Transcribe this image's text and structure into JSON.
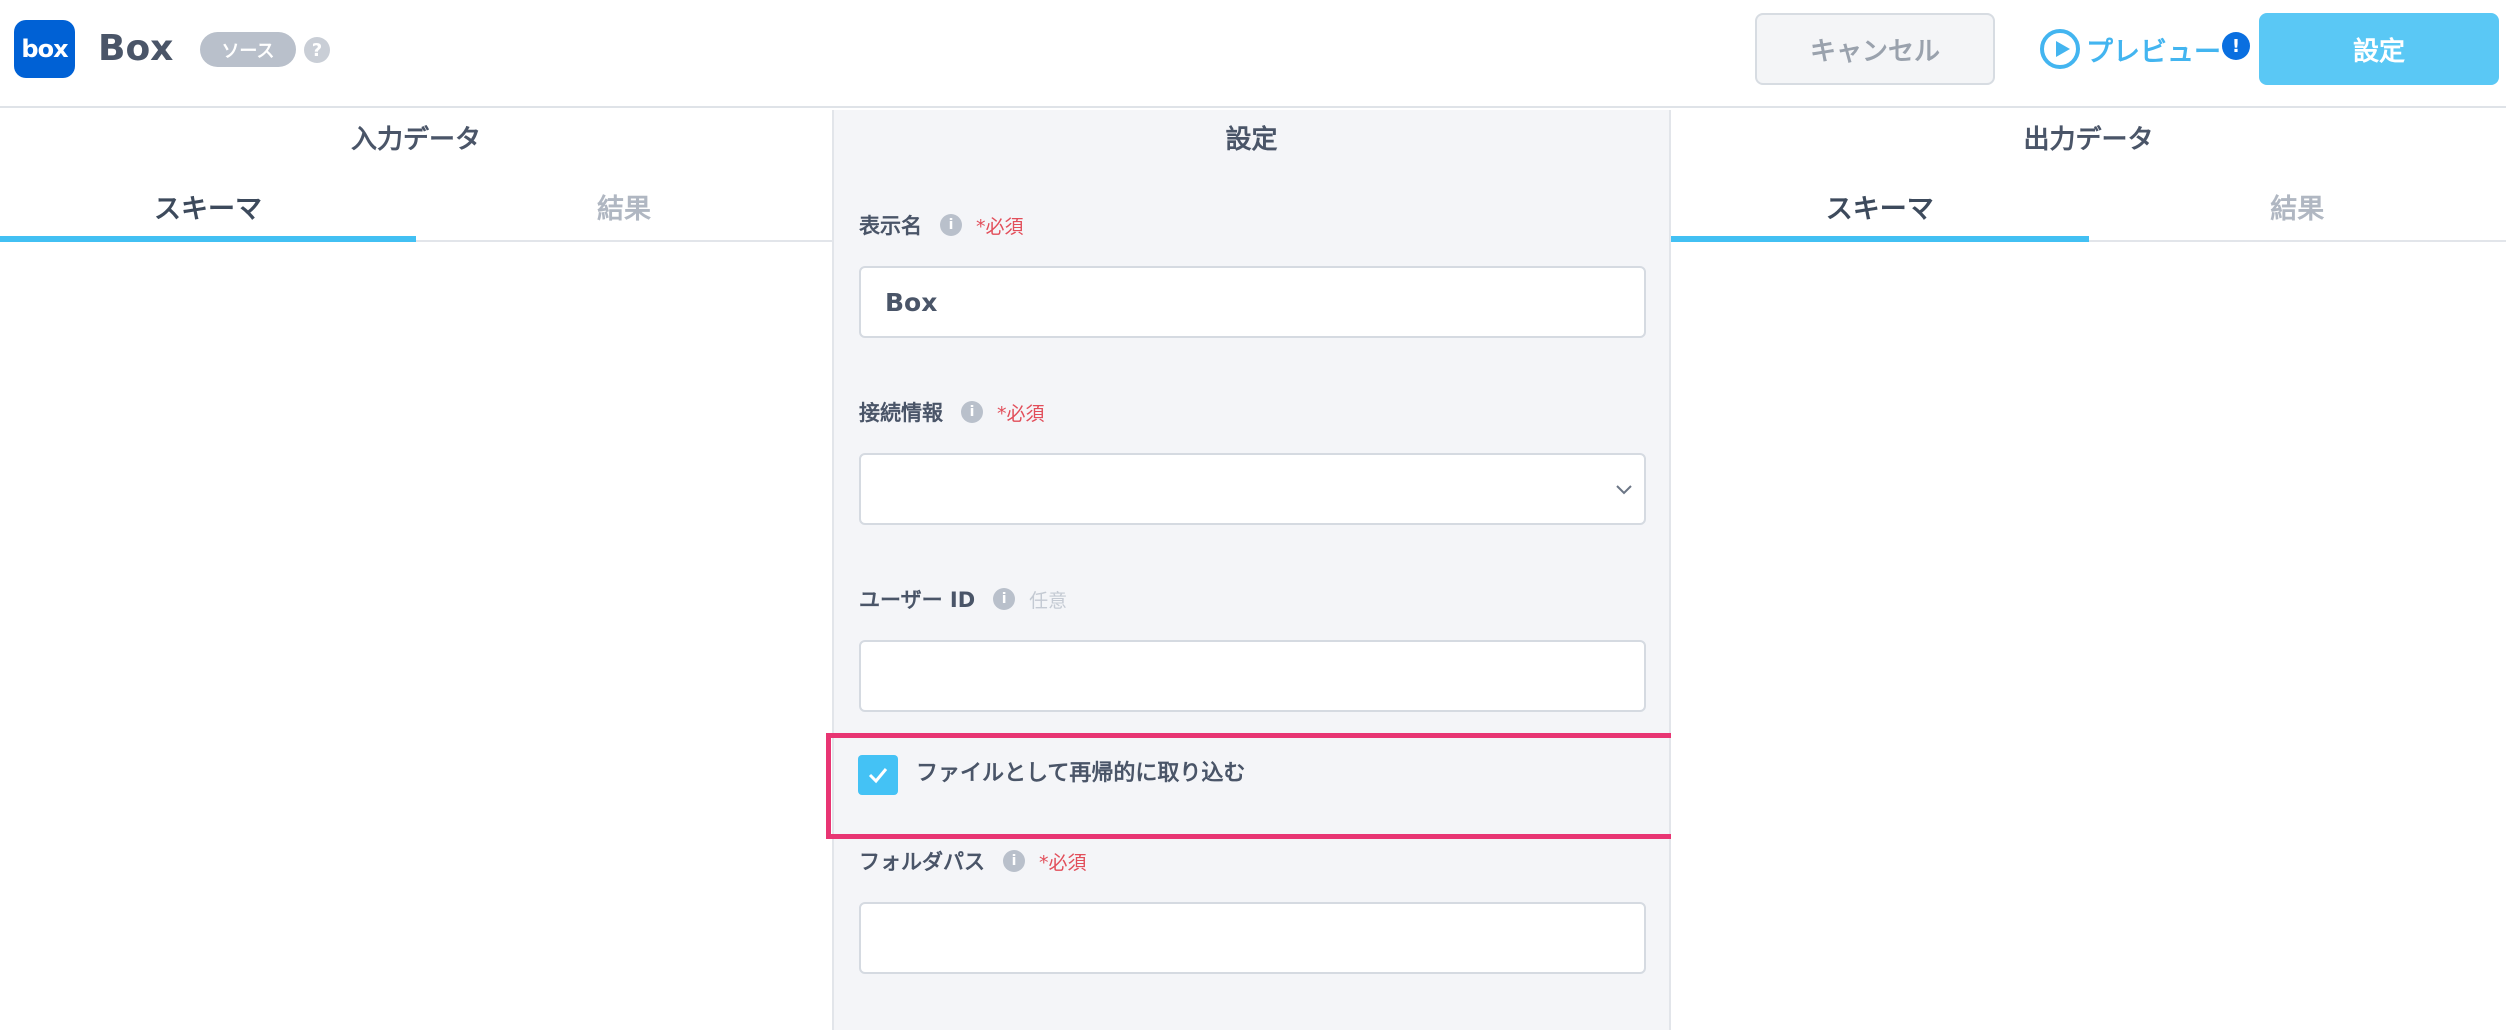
{
  "header": {
    "logo_text": "box",
    "title": "Box",
    "badge": "ソース",
    "help": "?",
    "cancel_label": "キャンセル",
    "preview_label": "プレビュー",
    "warn": "!",
    "settings_label": "設定"
  },
  "input_panel": {
    "title": "入力データ",
    "tabs": [
      "スキーマ",
      "結果"
    ]
  },
  "settings_panel": {
    "title": "設定",
    "fields": {
      "display_name": {
        "label": "表示名",
        "info": "i",
        "tag": "*必須",
        "value": "Box"
      },
      "connection": {
        "label": "接続情報",
        "info": "i",
        "tag": "*必須",
        "value": ""
      },
      "user_id": {
        "label": "ユーザー ID",
        "info": "i",
        "tag": "任意",
        "value": ""
      },
      "recursive": {
        "label": "ファイルとして再帰的に取り込む",
        "checked": true
      },
      "folder_path": {
        "label": "フォルダパス",
        "info": "i",
        "tag": "*必須",
        "value": ""
      }
    }
  },
  "output_panel": {
    "title": "出力データ",
    "tabs": [
      "スキーマ",
      "結果"
    ]
  },
  "colors": {
    "accent": "#42c0f3",
    "box_blue": "#0061d5",
    "highlight": "#e83573",
    "required": "#e24e5a"
  }
}
